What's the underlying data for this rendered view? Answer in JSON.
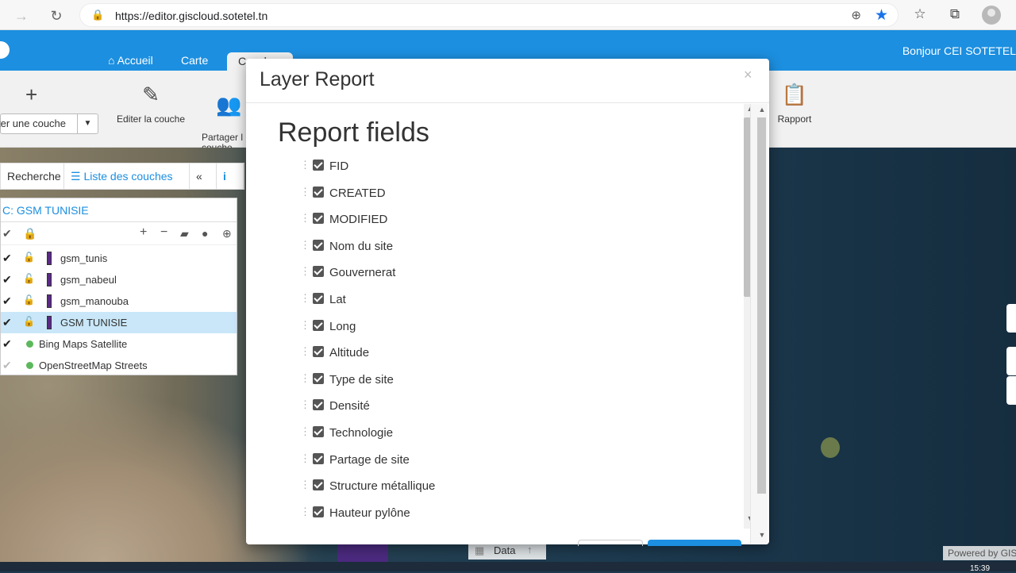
{
  "browser": {
    "url": "https://editor.giscloud.sotetel.tn"
  },
  "app": {
    "tabs": [
      "Accueil",
      "Carte",
      "Couches"
    ],
    "greeting": "Bonjour CEI SOTETEL"
  },
  "ribbon": {
    "add_layer": "ter une couche",
    "edit_layer": "Editer la couche",
    "share_layer": "Partager l\ncouche",
    "report": "Rapport"
  },
  "left_panel": {
    "tab_search": "Recherche",
    "tab_layers": "Liste des couches",
    "collapse": "«",
    "info": "i",
    "group_title": "C: GSM TUNISIE",
    "layers": [
      {
        "name": "gsm_tunis",
        "checked": true,
        "selected": false,
        "type": "vector"
      },
      {
        "name": "gsm_nabeul",
        "checked": true,
        "selected": false,
        "type": "vector"
      },
      {
        "name": "gsm_manouba",
        "checked": true,
        "selected": false,
        "type": "vector"
      },
      {
        "name": "GSM TUNISIE",
        "checked": true,
        "selected": true,
        "type": "vector"
      },
      {
        "name": "Bing Maps Satellite",
        "checked": true,
        "selected": false,
        "type": "tile"
      },
      {
        "name": "OpenStreetMap Streets",
        "checked": false,
        "selected": false,
        "type": "tile"
      }
    ]
  },
  "bottom": {
    "data": "Data",
    "powered": "Powered by GIS",
    "clock": "15:39"
  },
  "modal": {
    "title": "Layer Report",
    "close": "×",
    "section_title": "Report fields",
    "fields": [
      "FID",
      "CREATED",
      "MODIFIED",
      "Nom du site",
      "Gouvernerat",
      "Lat",
      "Long",
      "Altitude",
      "Type de site",
      "Densité",
      "Technologie",
      "Partage de site",
      "Structure métallique",
      "Hauteur pylône"
    ]
  }
}
